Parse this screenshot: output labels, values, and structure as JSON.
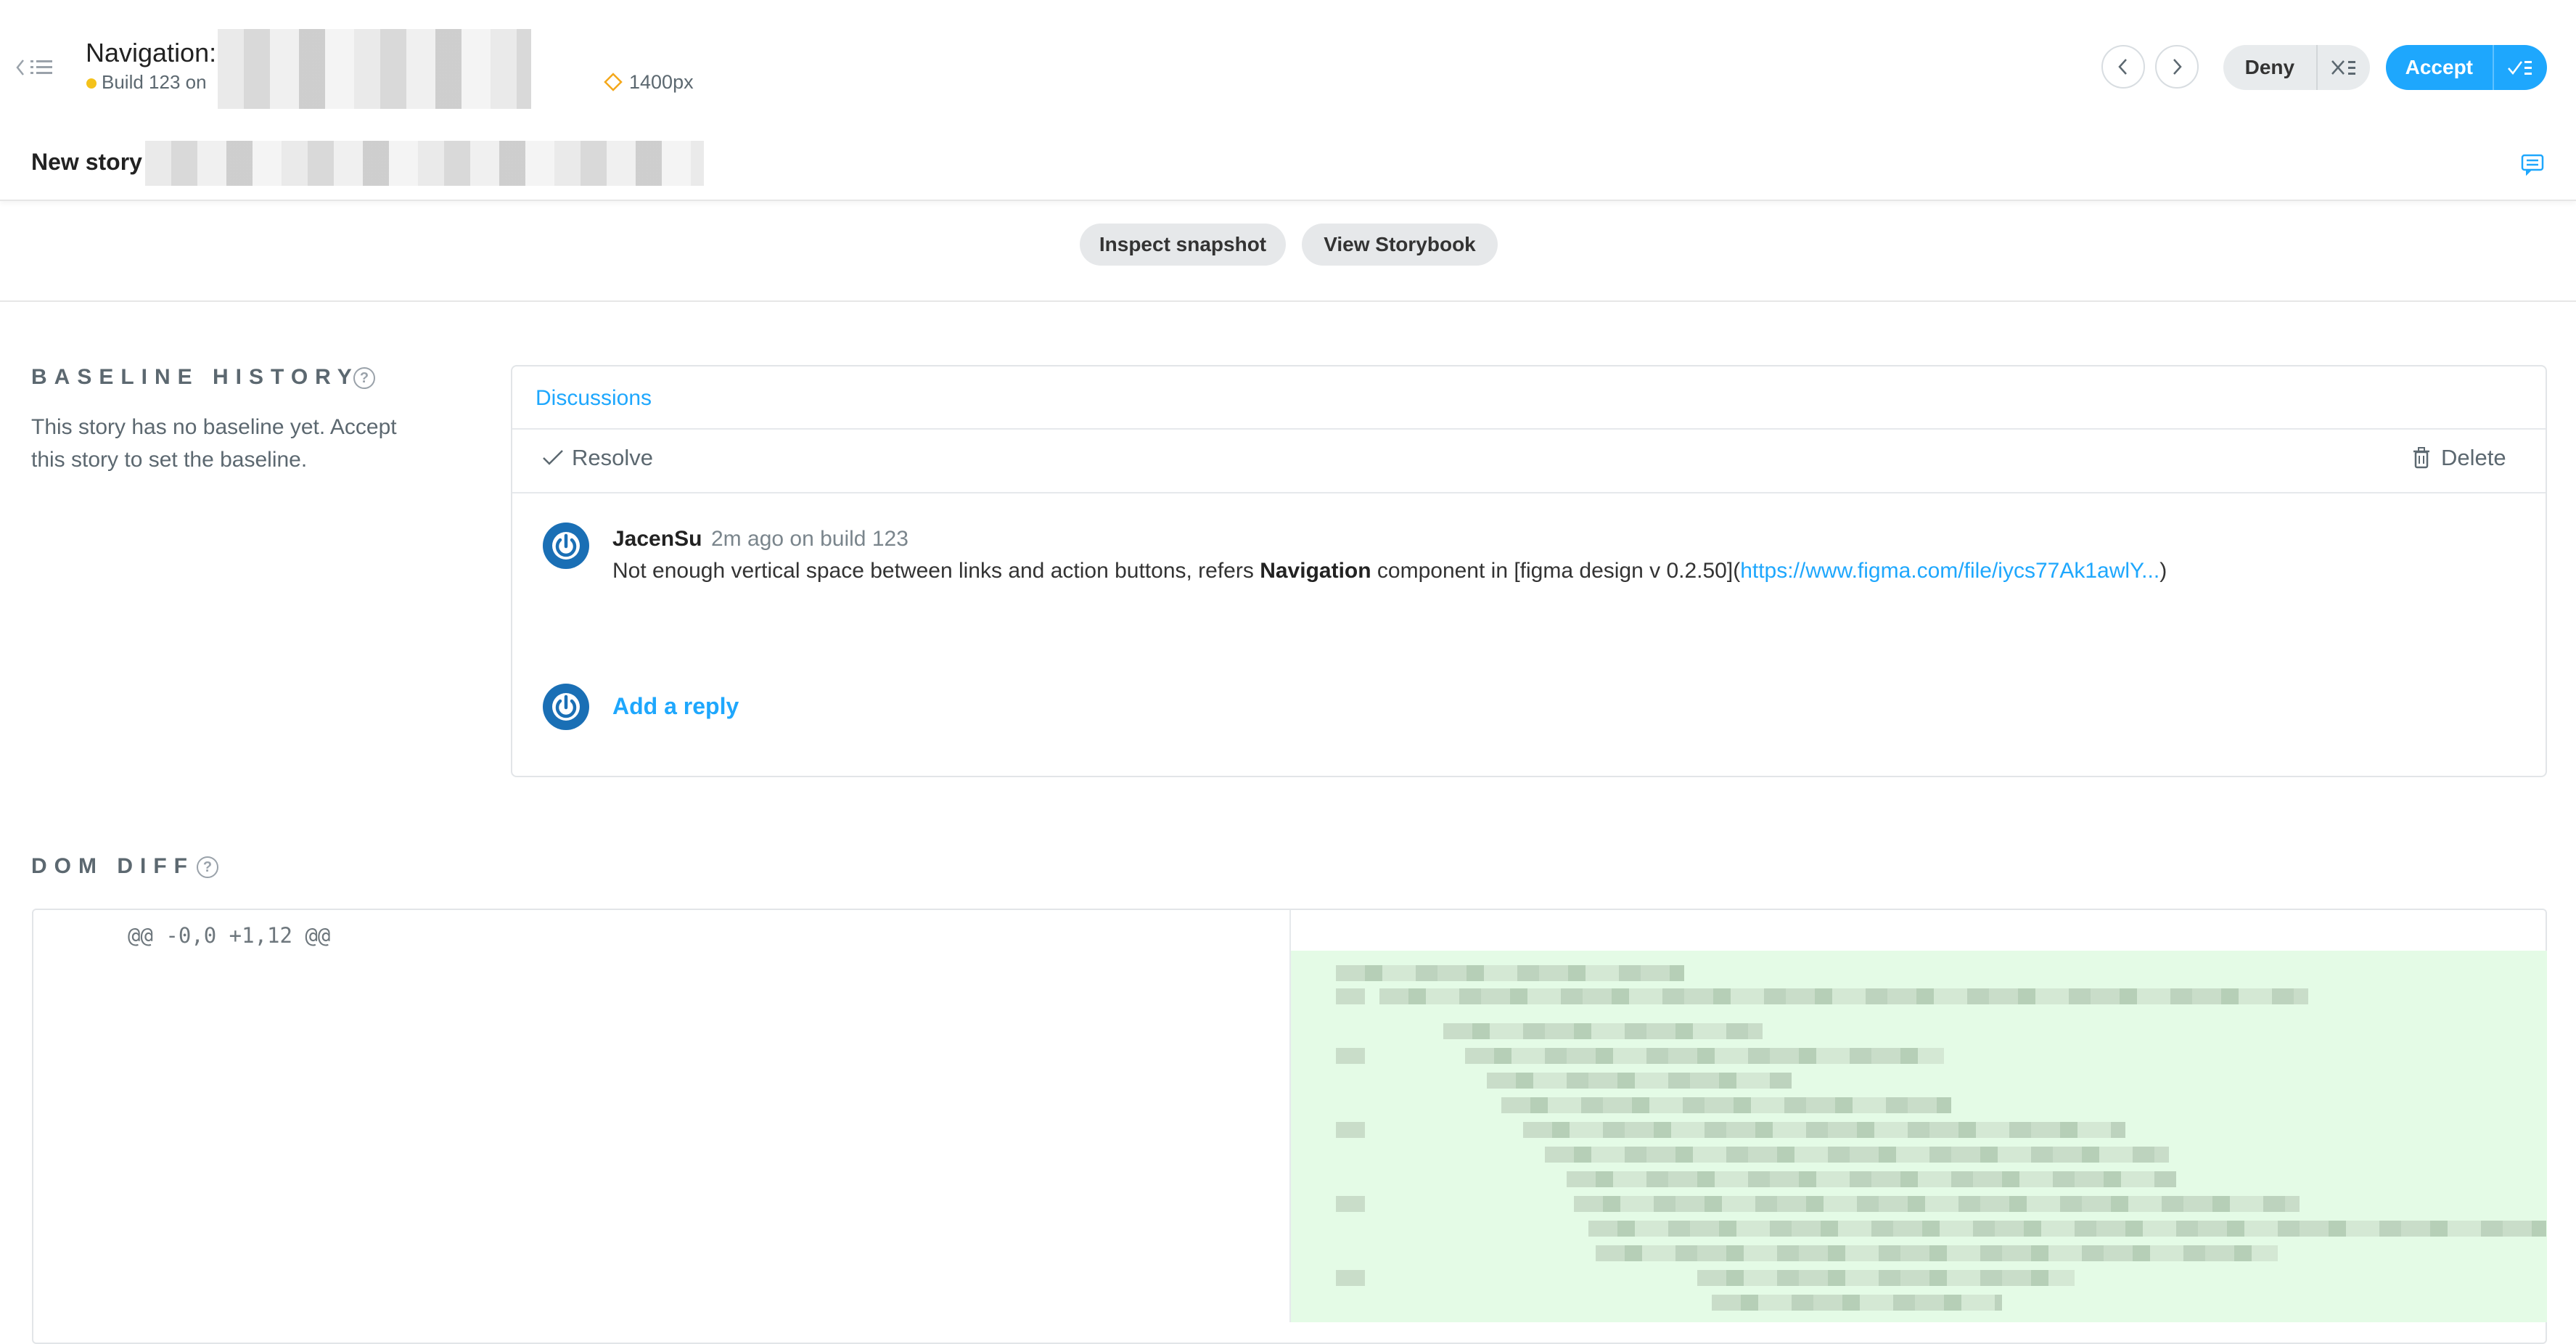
{
  "header": {
    "title": "Navigation",
    "title_separator": ":",
    "build_text": "Build 123 on",
    "viewport": "1400px",
    "story_label": "New story",
    "progress": 0.05
  },
  "review": {
    "deny_label": "Deny",
    "accept_label": "Accept"
  },
  "actions": {
    "inspect_label": "Inspect snapshot",
    "storybook_label": "View Storybook"
  },
  "baseline": {
    "heading": "BASELINE HISTORY",
    "text": "This story has no baseline yet. Accept this story to set the baseline."
  },
  "discussions": {
    "tab_label": "Discussions",
    "resolve_label": "Resolve",
    "delete_label": "Delete",
    "comment": {
      "author": "JacenSu",
      "meta": "2m ago on build 123",
      "text_before": "Not enough vertical space between links and action buttons, refers ",
      "text_bold": "Navigation",
      "text_after": " component in [figma design v 0.2.50](",
      "link": "https://www.figma.com/file/iycs77Ak1awlY...",
      "text_end": ")"
    },
    "reply_label": "Add a reply"
  },
  "dom_diff": {
    "heading": "DOM DIFF",
    "hunk_header": "@@ -0,0 +1,12 @@"
  },
  "colors": {
    "accent": "#1ea7fd",
    "added_bg": "#e4fbe6",
    "avatar": "#1a6fb5",
    "build_dot": "#f4c21b",
    "viewport_icon": "#f4a81b"
  }
}
